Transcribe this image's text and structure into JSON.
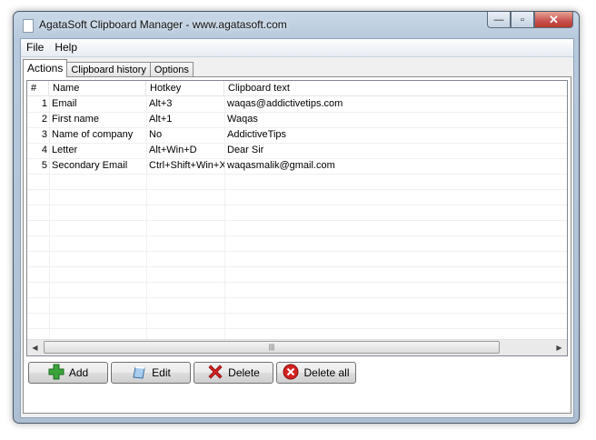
{
  "window": {
    "title": "AgataSoft Clipboard Manager - www.agatasoft.com"
  },
  "caption": {
    "minimize": "—",
    "maximize": "▫",
    "close": "✕"
  },
  "menu": [
    {
      "label": "File"
    },
    {
      "label": "Help"
    }
  ],
  "tabs": [
    {
      "label": "Actions",
      "active": true
    },
    {
      "label": "Clipboard history",
      "active": false
    },
    {
      "label": "Options",
      "active": false
    }
  ],
  "table": {
    "columns": [
      {
        "label": "#"
      },
      {
        "label": "Name"
      },
      {
        "label": "Hotkey"
      },
      {
        "label": "Clipboard text"
      }
    ],
    "rows": [
      {
        "num": "1",
        "name": "Email",
        "hotkey": "Alt+3",
        "text": "waqas@addictivetips.com"
      },
      {
        "num": "2",
        "name": "First name",
        "hotkey": "Alt+1",
        "text": "Waqas"
      },
      {
        "num": "3",
        "name": "Name of company",
        "hotkey": "No",
        "text": "AddictiveTips"
      },
      {
        "num": "4",
        "name": "Letter",
        "hotkey": "Alt+Win+D",
        "text": "Dear Sir"
      },
      {
        "num": "5",
        "name": "Secondary Email",
        "hotkey": "Ctrl+Shift+Win+X",
        "text": "waqasmalik@gmail.com"
      }
    ]
  },
  "scrollbar": {
    "left_arrow": "◀",
    "right_arrow": "▶",
    "grip": "|||"
  },
  "buttons": [
    {
      "label": "Add",
      "icon": "plus-icon"
    },
    {
      "label": "Edit",
      "icon": "edit-icon"
    },
    {
      "label": "Delete",
      "icon": "delete-x-icon"
    },
    {
      "label": "Delete all",
      "icon": "delete-all-icon"
    }
  ],
  "colors": {
    "add_green": "#3aa33a",
    "delete_red": "#d42020",
    "edit_blue": "#7fb0e0"
  }
}
